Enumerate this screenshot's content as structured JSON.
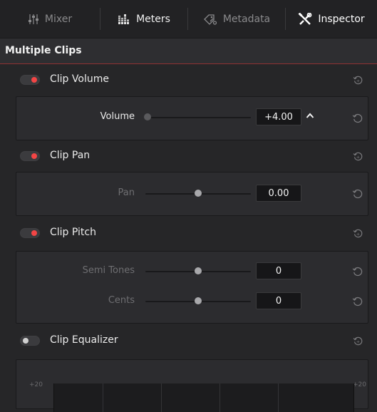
{
  "tabs": [
    {
      "label": "Mixer",
      "icon": "mixer-sliders-icon",
      "state": "inactive"
    },
    {
      "label": "Meters",
      "icon": "meters-bars-icon",
      "state": "active"
    },
    {
      "label": "Metadata",
      "icon": "metadata-tag-icon",
      "state": "inactive"
    },
    {
      "label": "Inspector",
      "icon": "inspector-tools-icon",
      "state": "selected"
    }
  ],
  "header": {
    "title": "Multiple Clips"
  },
  "groups": {
    "volume": {
      "label": "Clip Volume",
      "enabled": true
    },
    "pan": {
      "label": "Clip Pan",
      "enabled": true
    },
    "pitch": {
      "label": "Clip Pitch",
      "enabled": true
    },
    "equalizer": {
      "label": "Clip Equalizer",
      "enabled": false
    }
  },
  "params": {
    "volume": {
      "label": "Volume",
      "value": "+4.00",
      "level": 0.0
    },
    "pan": {
      "label": "Pan",
      "value": "0.00",
      "level": 0.5
    },
    "semitones": {
      "label": "Semi Tones",
      "value": "0",
      "level": 0.5
    },
    "cents": {
      "label": "Cents",
      "value": "0",
      "level": 0.5
    }
  },
  "eq": {
    "left_label": "+20",
    "right_label": "+20"
  },
  "colors": {
    "accent_red": "#f34545",
    "header_underline": "#8e3232",
    "background": "#262628"
  }
}
